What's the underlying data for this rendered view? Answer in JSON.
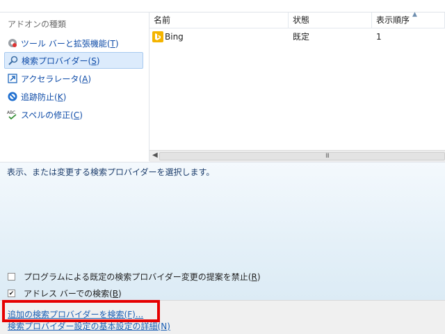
{
  "sidebar": {
    "header": "アドオンの種類",
    "items": [
      {
        "label": "ツール バーと拡張機能(",
        "key": "T",
        "suffix": ")",
        "icon": "gear-icon"
      },
      {
        "label": "検索プロバイダー(",
        "key": "S",
        "suffix": ")",
        "icon": "search-icon"
      },
      {
        "label": "アクセラレータ(",
        "key": "A",
        "suffix": ")",
        "icon": "accelerator-icon"
      },
      {
        "label": "追跡防止(",
        "key": "K",
        "suffix": ")",
        "icon": "block-icon"
      },
      {
        "label": "スペルの修正(",
        "key": "C",
        "suffix": ")",
        "icon": "spellcheck-icon"
      }
    ]
  },
  "table": {
    "columns": [
      "名前",
      "状態",
      "表示順序"
    ],
    "rows": [
      {
        "name": "Bing",
        "status": "既定",
        "order": "1"
      }
    ],
    "scroll_grip": "III"
  },
  "detail": {
    "description": "表示、または変更する検索プロバイダーを選択します。",
    "checkbox1": {
      "label": "プログラムによる既定の検索プロバイダー変更の提案を禁止(",
      "key": "R",
      "suffix": ")",
      "checked": false
    },
    "checkbox2": {
      "label": "アドレス バーでの検索(",
      "key": "B",
      "suffix": ")",
      "checked": true
    }
  },
  "footer": {
    "link1": "追加の検索プロバイダーを検索(F)...",
    "link2_text": "検索プロバイダー設定の基本設定の詳細(",
    "link2_key": "N",
    "link2_suffix": ")"
  },
  "colors": {
    "link": "#1a5fb4",
    "selected_bg": "#dcebfc",
    "highlight": "#e60000"
  }
}
